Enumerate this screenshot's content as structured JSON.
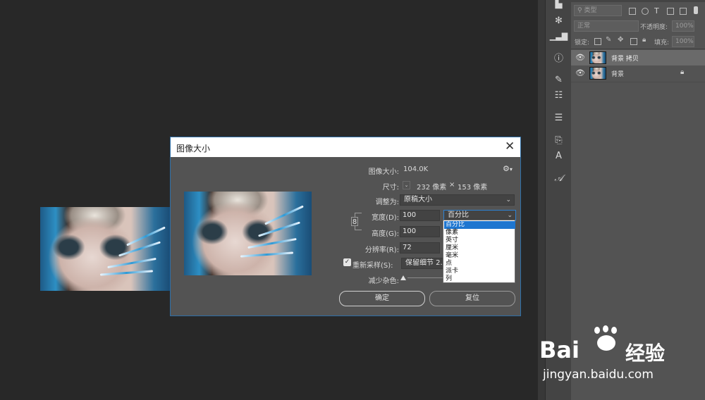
{
  "colors": {
    "accent": "#1e76d0",
    "workspace": "#282828",
    "panel": "#535353",
    "dialog_border": "#2e6fa8"
  },
  "layers_panel": {
    "filter_kind": "类型",
    "blend_mode": "正常",
    "opacity_label": "不透明度:",
    "opacity_value": "100%",
    "lock_label": "锁定:",
    "fill_label": "填充:",
    "fill_value": "100%",
    "layers": [
      {
        "name": "背景 拷贝",
        "selected": true,
        "locked": false
      },
      {
        "name": "背景",
        "selected": false,
        "locked": true
      }
    ]
  },
  "toolbar_icons": [
    "history-icon",
    "snowflake-icon",
    "histogram-icon",
    "info-icon",
    "brush-settings-icon",
    "adjustments-icon",
    "properties-icon",
    "clone-source-icon",
    "character-icon",
    "glyphs-icon"
  ],
  "dialog": {
    "title": "图像大小",
    "image_size_label": "图像大小:",
    "image_size_value": "104.0K",
    "dimensions_label": "尺寸:",
    "dimensions_width": "232 像素",
    "dimensions_x": "×",
    "dimensions_height": "153 像素",
    "fit_to_label": "调整为:",
    "fit_to_value": "原稿大小",
    "width_label": "宽度(D):",
    "width_value": "100",
    "width_unit": "百分比",
    "height_label": "高度(G):",
    "height_value": "100",
    "resolution_label": "分辨率(R):",
    "resolution_value": "72",
    "resample_label": "重新采样(S):",
    "resample_checked": true,
    "resample_value": "保留细节 2.",
    "reduce_noise_label": "减少杂色:",
    "ok_label": "确定",
    "reset_label": "复位",
    "unit_options": [
      "百分比",
      "像素",
      "英寸",
      "厘米",
      "毫米",
      "点",
      "派卡",
      "列"
    ],
    "unit_selected_index": 0
  },
  "watermark": {
    "brand": "Bai",
    "brand2": "经验",
    "url": "jingyan.baidu.com"
  }
}
